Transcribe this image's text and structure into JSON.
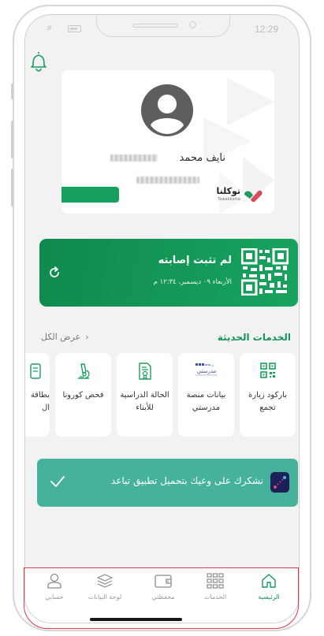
{
  "status_bar": {
    "time": "12:29",
    "signal": ".ııl"
  },
  "id_card": {
    "name_visible": "نايف محمد",
    "logo_text": "توكلنا",
    "logo_subtext": "Tawakkalna"
  },
  "vaccine_card": {
    "title": "لم تثبت إصابته",
    "date": "الأربعاء ٠٩ ديسمبر، ١٢:٣٤ م"
  },
  "services": {
    "title": "الخدمات الحديثة",
    "view_all": "عرض الكل",
    "items": [
      {
        "label": "باركود زيارة تجمع",
        "icon": "qr-icon"
      },
      {
        "label": "بيانات منصة مدرستي",
        "icon": "madrasati-logo"
      },
      {
        "label": "الحالة الدراسية للأبناء",
        "icon": "document-badge-icon"
      },
      {
        "label": "فحص كورونا",
        "icon": "microscope-icon"
      },
      {
        "label": "بطاقة ال",
        "icon": "card-icon"
      }
    ]
  },
  "toast": {
    "message": "نشكرك على وعيك بتحميل تطبيق تباعد"
  },
  "nav": {
    "items": [
      {
        "label": "الرئيسية",
        "icon": "home-icon",
        "active": true
      },
      {
        "label": "الخدمات",
        "icon": "grid-icon",
        "active": false
      },
      {
        "label": "محفظتي",
        "icon": "wallet-icon",
        "active": false
      },
      {
        "label": "لوحة البيانات",
        "icon": "layers-icon",
        "active": false
      },
      {
        "label": "حسابي",
        "icon": "user-icon",
        "active": false
      }
    ]
  },
  "colors": {
    "brand_green": "#14965a",
    "toast_teal": "#46b29b",
    "highlight_red": "#e23a4a"
  }
}
